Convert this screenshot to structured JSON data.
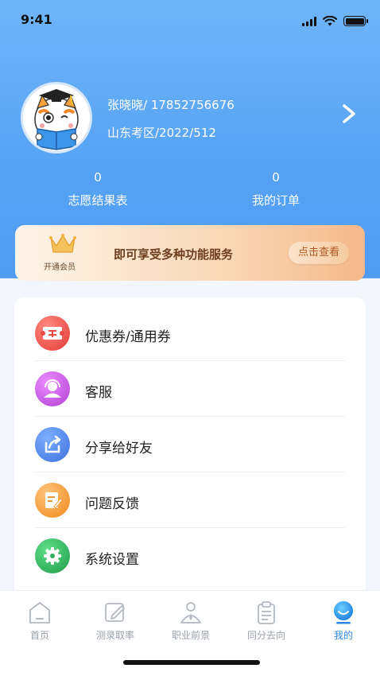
{
  "status_bar": {
    "time": "9:41"
  },
  "profile": {
    "name_phone": "张晓晓/ 17852756676",
    "region_info": "山东考区/2022/512"
  },
  "stats": [
    {
      "count": "0",
      "label": "志愿结果表"
    },
    {
      "count": "0",
      "label": "我的订单"
    }
  ],
  "vip_banner": {
    "label": "开通会员",
    "text": "即可享受多种功能服务",
    "button": "点击查看"
  },
  "menu": [
    {
      "label": "优惠券/通用券",
      "icon": "coupon-icon",
      "color": "#ef5350"
    },
    {
      "label": "客服",
      "icon": "customer-service-icon",
      "color": "#c74be0"
    },
    {
      "label": "分享给好友",
      "icon": "share-icon",
      "color": "#4f86e8"
    },
    {
      "label": "问题反馈",
      "icon": "feedback-icon",
      "color": "#f59b3c"
    },
    {
      "label": "系统设置",
      "icon": "settings-icon",
      "color": "#2fb35c"
    }
  ],
  "tabs": [
    {
      "label": "首页",
      "icon": "home-icon"
    },
    {
      "label": "测录取率",
      "icon": "edit-icon"
    },
    {
      "label": "职业前景",
      "icon": "career-icon"
    },
    {
      "label": "同分去向",
      "icon": "clipboard-icon"
    },
    {
      "label": "我的",
      "icon": "profile-icon",
      "active": true
    }
  ],
  "colors": {
    "accent": "#2d86e8",
    "hero": "#56a3f5",
    "vip_text": "#6e3e1e"
  }
}
